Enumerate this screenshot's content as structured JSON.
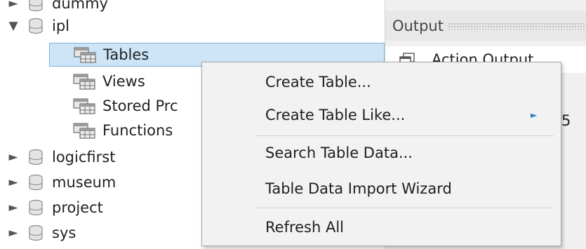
{
  "tree": {
    "items": [
      {
        "name": "dummy",
        "arrow": "►",
        "kind": "schema"
      },
      {
        "name": "ipl",
        "arrow": "▼",
        "kind": "schema"
      },
      {
        "name": "Tables",
        "kind": "folder",
        "selected": true
      },
      {
        "name": "Views",
        "kind": "folder"
      },
      {
        "name": "Stored Prc",
        "kind": "folder"
      },
      {
        "name": "Functions",
        "kind": "folder"
      },
      {
        "name": "logicfirst",
        "arrow": "►",
        "kind": "schema"
      },
      {
        "name": "museum",
        "arrow": "►",
        "kind": "schema"
      },
      {
        "name": "project",
        "arrow": "►",
        "kind": "schema"
      },
      {
        "name": "sys",
        "arrow": "►",
        "kind": "schema"
      }
    ]
  },
  "output": {
    "title": "Output",
    "action_label": "Action Output",
    "partial_value": "5"
  },
  "context_menu": {
    "items": [
      {
        "label": "Create Table...",
        "submenu": false
      },
      {
        "label": "Create Table Like...",
        "submenu": true,
        "arrow": "►"
      },
      {
        "label": "Search Table Data...",
        "submenu": false
      },
      {
        "label": "Table Data Import Wizard",
        "submenu": false
      },
      {
        "label": "Refresh All",
        "submenu": false
      }
    ]
  },
  "colors": {
    "selection_bg": "#cde5f7",
    "selection_border": "#7fb4de",
    "menu_bg": "#f2f2f2",
    "submenu_arrow": "#2b79c2"
  }
}
